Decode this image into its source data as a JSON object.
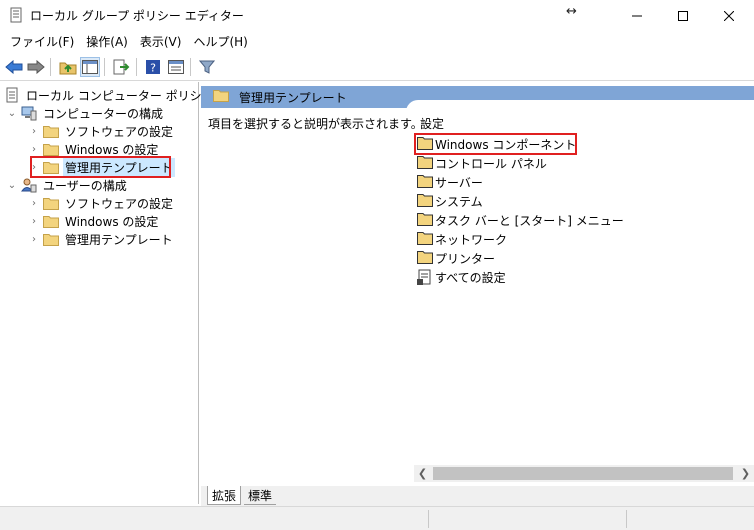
{
  "window": {
    "title": "ローカル グループ ポリシー エディター",
    "resize_glyph": "↔"
  },
  "menu": [
    "ファイル(F)",
    "操作(A)",
    "表示(V)",
    "ヘルプ(H)"
  ],
  "tree": {
    "root": "ローカル コンピューター ポリシー",
    "computer": {
      "label": "コンピューターの構成",
      "children": [
        "ソフトウェアの設定",
        "Windows の設定",
        "管理用テンプレート"
      ]
    },
    "user": {
      "label": "ユーザーの構成",
      "children": [
        "ソフトウェアの設定",
        "Windows の設定",
        "管理用テンプレート"
      ]
    }
  },
  "right": {
    "header": "管理用テンプレート",
    "description": "項目を選択すると説明が表示されます。",
    "list_header": "設定",
    "items": [
      "Windows コンポーネント",
      "コントロール パネル",
      "サーバー",
      "システム",
      "タスク バーと [スタート] メニュー",
      "ネットワーク",
      "プリンター",
      "すべての設定"
    ]
  },
  "tabs": [
    "拡張",
    "標準"
  ],
  "colors": {
    "header_bg": "#7fa5d6",
    "selection": "#cce8ff",
    "highlight_box": "#e02020",
    "folder": "#e8c46a"
  }
}
